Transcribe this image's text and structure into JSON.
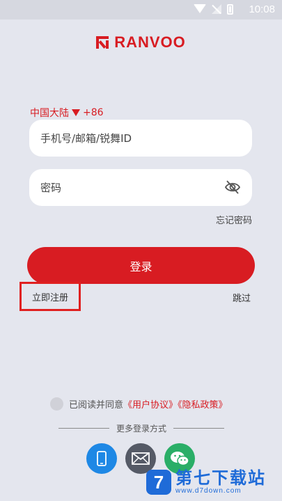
{
  "status_bar": {
    "time": "10:08",
    "icons": [
      "wifi-icon",
      "no-signal-icon",
      "battery-icon"
    ]
  },
  "brand": {
    "name": "RANVOO",
    "color": "#d81c22"
  },
  "login_form": {
    "region": "中国大陆",
    "country_code": "+86",
    "account_placeholder": "手机号/邮箱/锐舞ID",
    "password_placeholder": "密码",
    "forgot_password": "忘记密码",
    "login_button": "登录",
    "register_link": "立即注册",
    "skip_link": "跳过"
  },
  "agreement": {
    "prefix": "已阅读并同意",
    "user_agreement": "《用户协议》",
    "privacy_policy": "《隐私政策》"
  },
  "other_login": {
    "label": "更多登录方式",
    "methods": [
      "phone-icon",
      "mail-icon",
      "wechat-icon"
    ]
  },
  "watermark": {
    "title": "第七下载站",
    "url": "www.d7down.com"
  },
  "colors": {
    "accent": "#d81c22",
    "background": "#e4e6ee",
    "highlight_box": "#e02020"
  }
}
